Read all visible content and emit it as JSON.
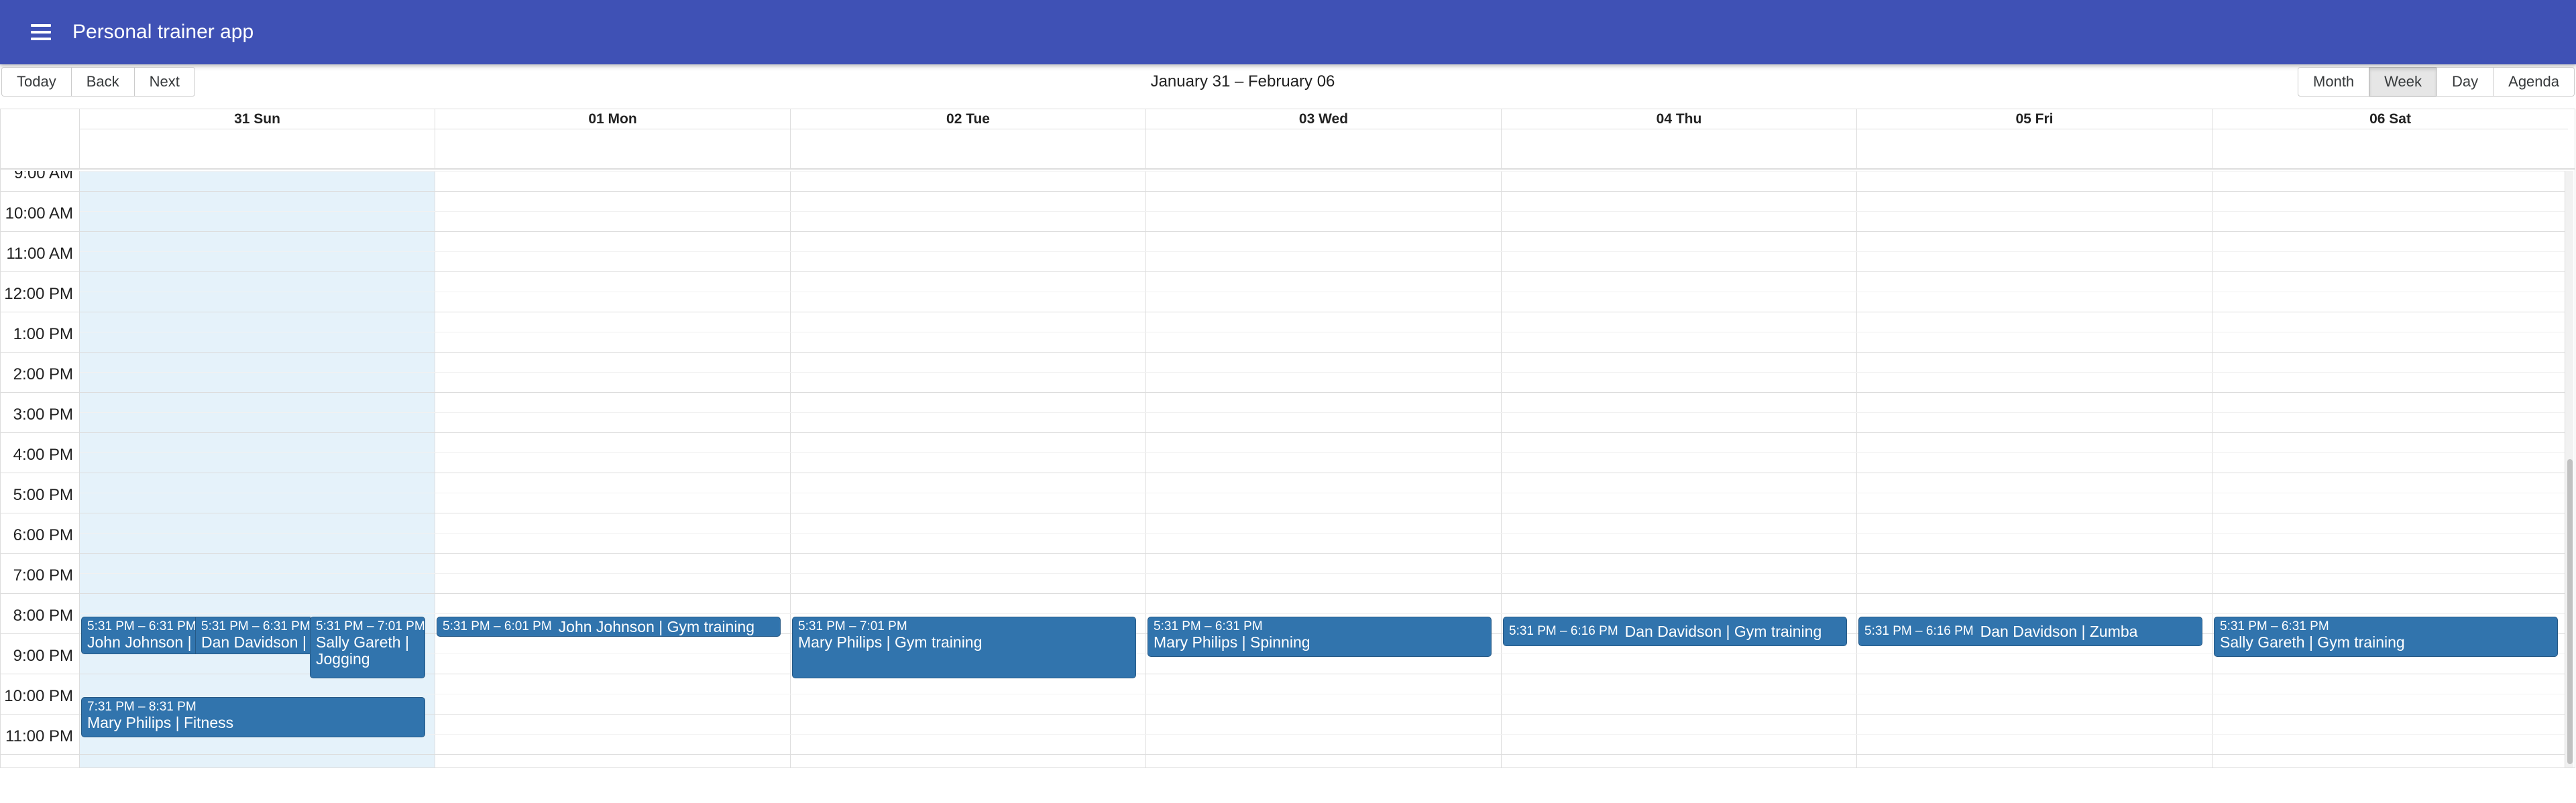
{
  "app": {
    "title": "Personal trainer app"
  },
  "toolbar": {
    "today": "Today",
    "back": "Back",
    "next": "Next",
    "range": "January 31 – February 06",
    "views": [
      "Month",
      "Week",
      "Day",
      "Agenda"
    ],
    "active_view": "Week"
  },
  "days": [
    "31 Sun",
    "01 Mon",
    "02 Tue",
    "03 Wed",
    "04 Thu",
    "05 Fri",
    "06 Sat"
  ],
  "times": [
    "9:00 AM",
    "10:00 AM",
    "11:00 AM",
    "12:00 PM",
    "1:00 PM",
    "2:00 PM",
    "3:00 PM",
    "4:00 PM",
    "5:00 PM",
    "6:00 PM",
    "7:00 PM",
    "8:00 PM",
    "9:00 PM",
    "10:00 PM",
    "11:00 PM"
  ],
  "events": [
    {
      "day": "31 Sun",
      "time": "5:31 PM – 6:31 PM",
      "title": "John Johnson | Gym training"
    },
    {
      "day": "31 Sun",
      "time": "5:31 PM – 6:31 PM",
      "title": "Dan Davidson | Spinning"
    },
    {
      "day": "31 Sun",
      "time": "5:31 PM – 7:01 PM",
      "title": "Sally Gareth | Jogging"
    },
    {
      "day": "31 Sun",
      "time": "7:31 PM – 8:31 PM",
      "title": "Mary Philips | Fitness"
    },
    {
      "day": "01 Mon",
      "time": "5:31 PM – 6:01 PM",
      "title": "John Johnson | Gym training"
    },
    {
      "day": "02 Tue",
      "time": "5:31 PM – 7:01 PM",
      "title": "Mary Philips | Gym training"
    },
    {
      "day": "03 Wed",
      "time": "5:31 PM – 6:31 PM",
      "title": "Mary Philips | Spinning"
    },
    {
      "day": "04 Thu",
      "time": "5:31 PM – 6:16 PM",
      "title": "Dan Davidson | Gym training"
    },
    {
      "day": "05 Fri",
      "time": "5:31 PM – 6:16 PM",
      "title": "Dan Davidson | Zumba"
    },
    {
      "day": "06 Sat",
      "time": "5:31 PM – 6:31 PM",
      "title": "Sally Gareth | Gym training"
    }
  ],
  "colors": {
    "appbar": "#3f51b5",
    "event": "#3174ad",
    "today_bg": "#eaf6ff"
  }
}
